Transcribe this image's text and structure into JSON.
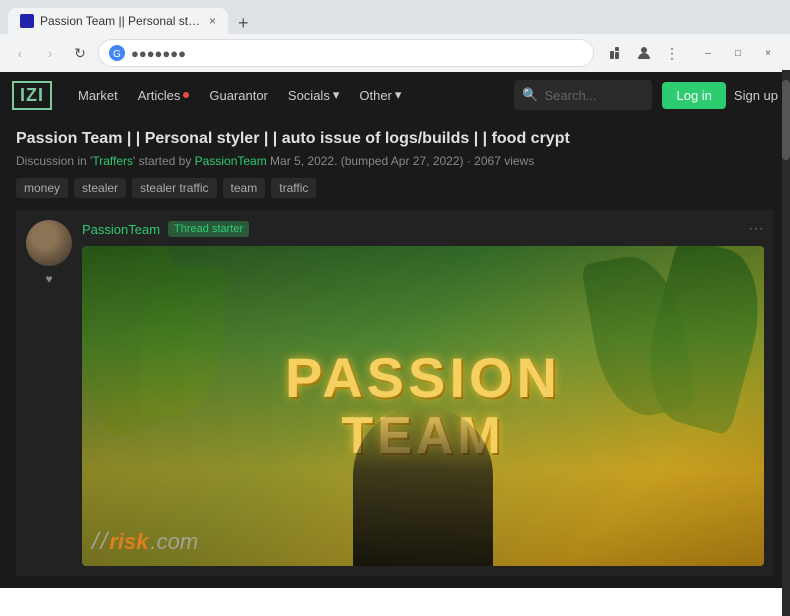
{
  "browser": {
    "tab_title": "Passion Team || Personal styler ||...",
    "address": "●●●●●●●",
    "tab_close": "×",
    "tab_new": "+",
    "controls": {
      "back": "‹",
      "forward": "›",
      "reload": "↻"
    },
    "window_btns": [
      "–",
      "□",
      "×"
    ]
  },
  "nav": {
    "logo": "IZI",
    "items": [
      {
        "label": "Market",
        "dot": false
      },
      {
        "label": "Articles",
        "dot": true
      },
      {
        "label": "Guarantor",
        "dot": false
      },
      {
        "label": "Socials",
        "dot": false,
        "arrow": true
      },
      {
        "label": "Other",
        "dot": false,
        "arrow": true
      }
    ],
    "search_placeholder": "Search...",
    "login_label": "Log in",
    "signup_label": "Sign up"
  },
  "post": {
    "title": "Passion Team | | Personal styler | | auto issue of logs/builds | | food crypt",
    "meta": "Discussion in 'Traffers' started by PassionTeam  Mar 5, 2022. (bumped Apr 27, 2022)  ·  2067 views",
    "tags": [
      "money",
      "stealer",
      "stealer traffic",
      "team",
      "traffic"
    ],
    "author": "PassionTeam",
    "thread_starter_badge": "Thread starter",
    "options": "···",
    "image_passion": "PASSION",
    "image_team": "TEAM",
    "watermark_logo": "/ /",
    "watermark_risk": "risk",
    "watermark_com": ".com"
  }
}
